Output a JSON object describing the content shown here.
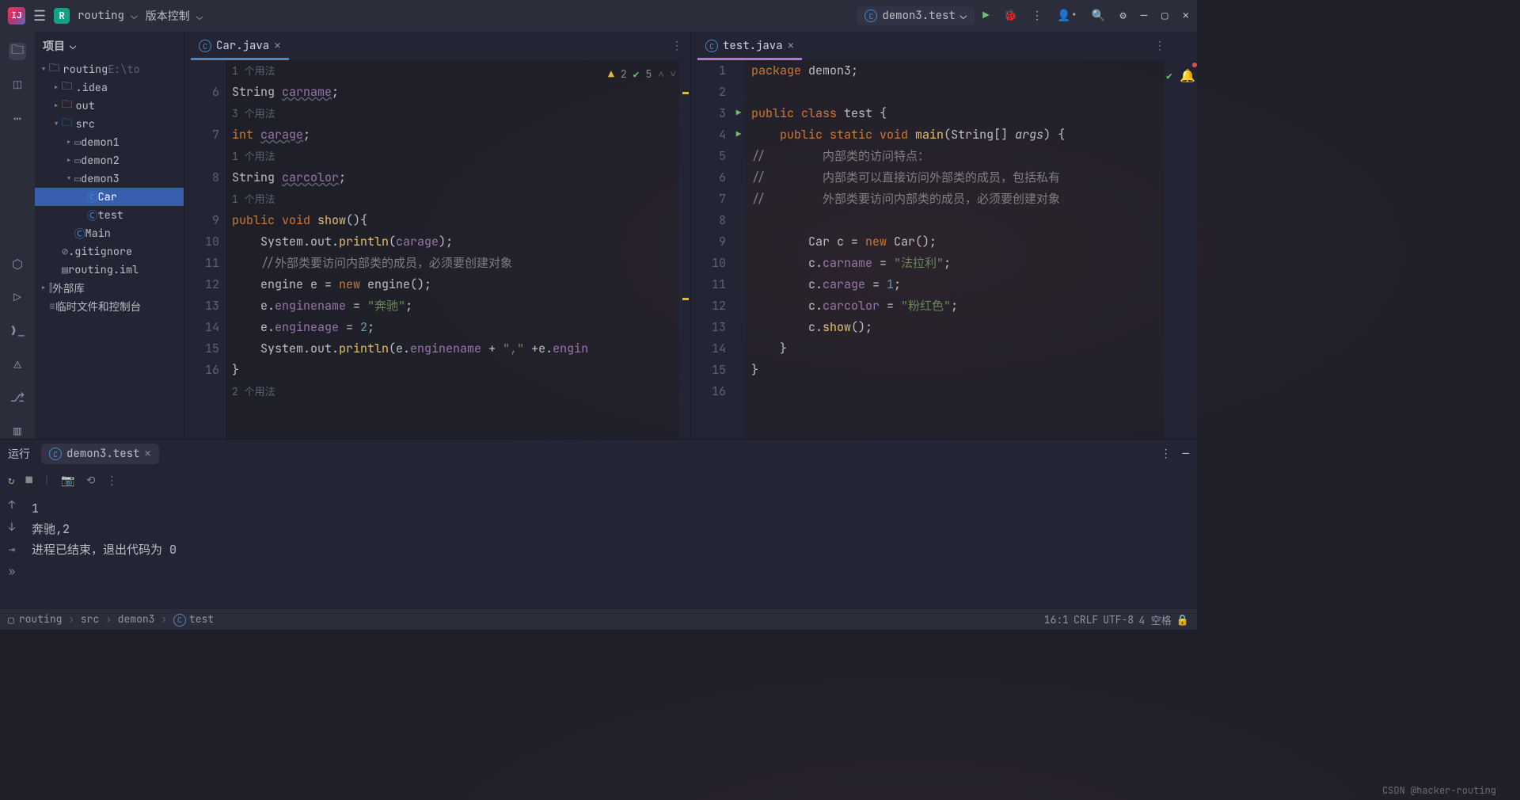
{
  "titlebar": {
    "app_logo": "IJ",
    "project_badge": "R",
    "project_name": "routing",
    "vcs_menu": "版本控制",
    "run_config": "demon3.test"
  },
  "left_gutter": {
    "items": [
      "folder",
      "structure",
      "more"
    ]
  },
  "project_panel": {
    "title": "项目",
    "tree": [
      {
        "indent": 0,
        "caret": "▾",
        "icon": "folder",
        "label": "routing",
        "extra": "E:\\to",
        "selected": false
      },
      {
        "indent": 1,
        "caret": "▸",
        "icon": "folder",
        "label": ".idea"
      },
      {
        "indent": 1,
        "caret": "▸",
        "icon": "folder-orange",
        "label": "out"
      },
      {
        "indent": 1,
        "caret": "▾",
        "icon": "folder-blue",
        "label": "src"
      },
      {
        "indent": 2,
        "caret": "▸",
        "icon": "pkg",
        "label": "demon1"
      },
      {
        "indent": 2,
        "caret": "▸",
        "icon": "pkg",
        "label": "demon2"
      },
      {
        "indent": 2,
        "caret": "▾",
        "icon": "pkg",
        "label": "demon3"
      },
      {
        "indent": 3,
        "caret": "",
        "icon": "class",
        "label": "Car",
        "selected": true
      },
      {
        "indent": 3,
        "caret": "",
        "icon": "class",
        "label": "test"
      },
      {
        "indent": 2,
        "caret": "",
        "icon": "class",
        "label": "Main"
      },
      {
        "indent": 1,
        "caret": "",
        "icon": "gitignore",
        "label": ".gitignore"
      },
      {
        "indent": 1,
        "caret": "",
        "icon": "iml",
        "label": "routing.iml"
      },
      {
        "indent": 0,
        "caret": "▸",
        "icon": "lib",
        "label": "外部库"
      },
      {
        "indent": 0,
        "caret": "",
        "icon": "scratch",
        "label": "临时文件和控制台"
      }
    ]
  },
  "editor_left": {
    "tab": "Car.java",
    "inspection": {
      "warn": "2",
      "ok": "5"
    },
    "lines": [
      {
        "n": "",
        "hint": "1 个用法"
      },
      {
        "n": "6",
        "tokens": [
          {
            "t": "String ",
            "c": "type"
          },
          {
            "t": "carname",
            "c": "field underline-wave"
          },
          {
            "t": ";",
            "c": ""
          }
        ]
      },
      {
        "n": "",
        "hint": "3 个用法"
      },
      {
        "n": "7",
        "tokens": [
          {
            "t": "int ",
            "c": "kw"
          },
          {
            "t": "carage",
            "c": "field underline-wave"
          },
          {
            "t": ";",
            "c": ""
          }
        ]
      },
      {
        "n": "",
        "hint": "1 个用法"
      },
      {
        "n": "8",
        "tokens": [
          {
            "t": "String ",
            "c": "type"
          },
          {
            "t": "carcolor",
            "c": "field underline-wave"
          },
          {
            "t": ";",
            "c": ""
          }
        ]
      },
      {
        "n": "",
        "hint": "1 个用法"
      },
      {
        "n": "9",
        "tokens": [
          {
            "t": "public ",
            "c": "kw"
          },
          {
            "t": "void ",
            "c": "kw"
          },
          {
            "t": "show",
            "c": "fn"
          },
          {
            "t": "(){",
            "c": ""
          }
        ]
      },
      {
        "n": "10",
        "tokens": [
          {
            "t": "    System.out.",
            "c": ""
          },
          {
            "t": "println",
            "c": "fn"
          },
          {
            "t": "(",
            "c": ""
          },
          {
            "t": "carage",
            "c": "field"
          },
          {
            "t": ");",
            "c": ""
          }
        ]
      },
      {
        "n": "11",
        "tokens": [
          {
            "t": "    //外部类要访问内部类的成员，必须要创建对象",
            "c": "cmt"
          }
        ]
      },
      {
        "n": "12",
        "tokens": [
          {
            "t": "    engine e = ",
            "c": ""
          },
          {
            "t": "new ",
            "c": "kw"
          },
          {
            "t": "engine();",
            "c": ""
          }
        ]
      },
      {
        "n": "13",
        "tokens": [
          {
            "t": "    e.",
            "c": ""
          },
          {
            "t": "enginename",
            "c": "field"
          },
          {
            "t": " = ",
            "c": ""
          },
          {
            "t": "\"奔驰\"",
            "c": "str"
          },
          {
            "t": ";",
            "c": ""
          }
        ]
      },
      {
        "n": "14",
        "tokens": [
          {
            "t": "    e.",
            "c": ""
          },
          {
            "t": "engineage",
            "c": "field"
          },
          {
            "t": " = ",
            "c": ""
          },
          {
            "t": "2",
            "c": "num"
          },
          {
            "t": ";",
            "c": ""
          }
        ]
      },
      {
        "n": "15",
        "tokens": [
          {
            "t": "    System.out.",
            "c": ""
          },
          {
            "t": "println",
            "c": "fn"
          },
          {
            "t": "(e.",
            "c": ""
          },
          {
            "t": "enginename",
            "c": "field"
          },
          {
            "t": " + ",
            "c": ""
          },
          {
            "t": "\",\"",
            "c": "str"
          },
          {
            "t": " +e.",
            "c": ""
          },
          {
            "t": "engin",
            "c": "field"
          }
        ]
      },
      {
        "n": "16",
        "tokens": [
          {
            "t": "}",
            "c": ""
          }
        ]
      },
      {
        "n": "",
        "hint": "2 个用法"
      }
    ]
  },
  "editor_right": {
    "tab": "test.java",
    "lines": [
      {
        "n": "1",
        "run": "",
        "tokens": [
          {
            "t": "package ",
            "c": "kw"
          },
          {
            "t": "demon3;",
            "c": ""
          }
        ]
      },
      {
        "n": "2",
        "run": "",
        "tokens": [
          {
            "t": "",
            "c": ""
          }
        ]
      },
      {
        "n": "3",
        "run": "▶",
        "tokens": [
          {
            "t": "public ",
            "c": "kw"
          },
          {
            "t": "class ",
            "c": "kw"
          },
          {
            "t": "test {",
            "c": ""
          }
        ]
      },
      {
        "n": "4",
        "run": "▶",
        "tokens": [
          {
            "t": "    public ",
            "c": "kw"
          },
          {
            "t": "static ",
            "c": "kw"
          },
          {
            "t": "void ",
            "c": "kw"
          },
          {
            "t": "main",
            "c": "fn"
          },
          {
            "t": "(String[] ",
            "c": ""
          },
          {
            "t": "args",
            "c": "param"
          },
          {
            "t": ") {",
            "c": ""
          }
        ]
      },
      {
        "n": "5",
        "run": "",
        "tokens": [
          {
            "t": "//        内部类的访问特点：",
            "c": "cmt"
          }
        ]
      },
      {
        "n": "6",
        "run": "",
        "tokens": [
          {
            "t": "//        内部类可以直接访问外部类的成员，包括私有",
            "c": "cmt"
          }
        ]
      },
      {
        "n": "7",
        "run": "",
        "tokens": [
          {
            "t": "//        外部类要访问内部类的成员，必须要创建对象",
            "c": "cmt"
          }
        ]
      },
      {
        "n": "8",
        "run": "",
        "tokens": [
          {
            "t": "",
            "c": ""
          }
        ]
      },
      {
        "n": "9",
        "run": "",
        "tokens": [
          {
            "t": "        Car c = ",
            "c": ""
          },
          {
            "t": "new ",
            "c": "kw"
          },
          {
            "t": "Car();",
            "c": ""
          }
        ]
      },
      {
        "n": "10",
        "run": "",
        "tokens": [
          {
            "t": "        c.",
            "c": ""
          },
          {
            "t": "carname",
            "c": "field"
          },
          {
            "t": " = ",
            "c": ""
          },
          {
            "t": "\"法拉利\"",
            "c": "str"
          },
          {
            "t": ";",
            "c": ""
          }
        ]
      },
      {
        "n": "11",
        "run": "",
        "tokens": [
          {
            "t": "        c.",
            "c": ""
          },
          {
            "t": "carage",
            "c": "field"
          },
          {
            "t": " = ",
            "c": ""
          },
          {
            "t": "1",
            "c": "num"
          },
          {
            "t": ";",
            "c": ""
          }
        ]
      },
      {
        "n": "12",
        "run": "",
        "tokens": [
          {
            "t": "        c.",
            "c": ""
          },
          {
            "t": "carcolor",
            "c": "field"
          },
          {
            "t": " = ",
            "c": ""
          },
          {
            "t": "\"粉红色\"",
            "c": "str"
          },
          {
            "t": ";",
            "c": ""
          }
        ]
      },
      {
        "n": "13",
        "run": "",
        "tokens": [
          {
            "t": "        c.",
            "c": ""
          },
          {
            "t": "show",
            "c": "fn"
          },
          {
            "t": "();",
            "c": ""
          }
        ]
      },
      {
        "n": "14",
        "run": "",
        "tokens": [
          {
            "t": "    }",
            "c": ""
          }
        ]
      },
      {
        "n": "15",
        "run": "",
        "tokens": [
          {
            "t": "}",
            "c": ""
          }
        ]
      },
      {
        "n": "16",
        "run": "",
        "tokens": [
          {
            "t": "",
            "c": ""
          }
        ]
      }
    ]
  },
  "run_panel": {
    "label": "运行",
    "tab": "demon3.test",
    "output": [
      "1",
      "奔驰,2",
      "",
      "进程已结束，退出代码为 0"
    ]
  },
  "footer": {
    "crumbs": [
      "routing",
      "src",
      "demon3",
      "test"
    ],
    "pos": "16:1",
    "eol": "CRLF",
    "enc": "UTF-8",
    "indent": "4 空格",
    "watermark": "CSDN @hacker-routing"
  }
}
